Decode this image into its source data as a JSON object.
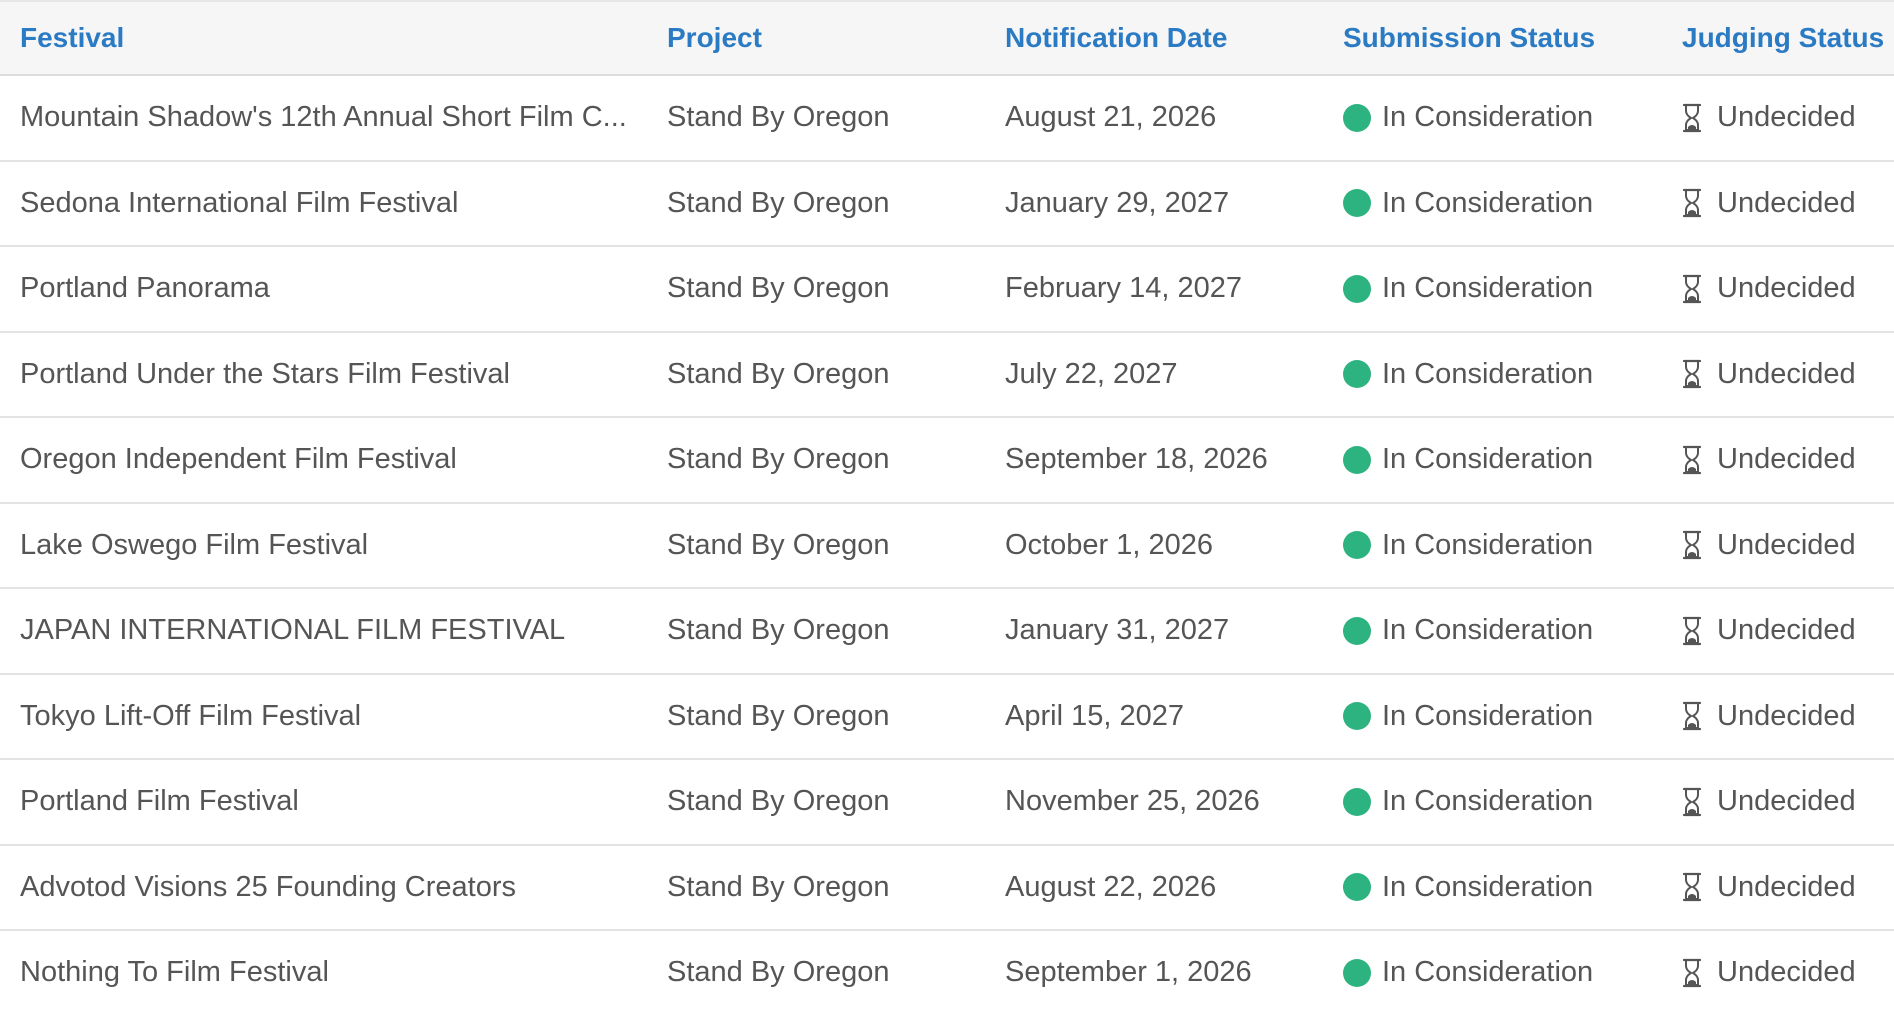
{
  "colors": {
    "header_text": "#2b7bc4",
    "status_dot": "#2db37f",
    "body_text": "#555555"
  },
  "header": {
    "festival": "Festival",
    "project": "Project",
    "notification_date": "Notification Date",
    "submission_status": "Submission Status",
    "judging_status": "Judging Status"
  },
  "rows": [
    {
      "festival": "Mountain Shadow's 12th Annual Short Film C...",
      "project": "Stand By Oregon",
      "date": "August 21, 2026",
      "submission": "In Consideration",
      "judging": "Undecided",
      "judging_icon": "hourglass-icon"
    },
    {
      "festival": "Sedona International Film Festival",
      "project": "Stand By Oregon",
      "date": "January 29, 2027",
      "submission": "In Consideration",
      "judging": "Undecided",
      "judging_icon": "hourglass-icon"
    },
    {
      "festival": "Portland Panorama",
      "project": "Stand By Oregon",
      "date": "February 14, 2027",
      "submission": "In Consideration",
      "judging": "Undecided",
      "judging_icon": "hourglass-icon"
    },
    {
      "festival": "Portland Under the Stars Film Festival",
      "project": "Stand By Oregon",
      "date": "July 22, 2027",
      "submission": "In Consideration",
      "judging": "Undecided",
      "judging_icon": "hourglass-icon"
    },
    {
      "festival": "Oregon Independent Film Festival",
      "project": "Stand By Oregon",
      "date": "September 18, 2026",
      "submission": "In Consideration",
      "judging": "Undecided",
      "judging_icon": "hourglass-icon"
    },
    {
      "festival": "Lake Oswego Film Festival",
      "project": "Stand By Oregon",
      "date": "October 1, 2026",
      "submission": "In Consideration",
      "judging": "Undecided",
      "judging_icon": "hourglass-icon"
    },
    {
      "festival": "JAPAN INTERNATIONAL FILM FESTIVAL",
      "project": "Stand By Oregon",
      "date": "January 31, 2027",
      "submission": "In Consideration",
      "judging": "Undecided",
      "judging_icon": "hourglass-icon"
    },
    {
      "festival": "Tokyo Lift-Off Film Festival",
      "project": "Stand By Oregon",
      "date": "April 15, 2027",
      "submission": "In Consideration",
      "judging": "Undecided",
      "judging_icon": "hourglass-icon"
    },
    {
      "festival": "Portland Film Festival",
      "project": "Stand By Oregon",
      "date": "November 25, 2026",
      "submission": "In Consideration",
      "judging": "Undecided",
      "judging_icon": "hourglass-icon"
    },
    {
      "festival": "Advotod Visions 25 Founding Creators",
      "project": "Stand By Oregon",
      "date": "August 22, 2026",
      "submission": "In Consideration",
      "judging": "Undecided",
      "judging_icon": "hourglass-icon"
    },
    {
      "festival": "Nothing To Film Festival",
      "project": "Stand By Oregon",
      "date": "September 1, 2026",
      "submission": "In Consideration",
      "judging": "Undecided",
      "judging_icon": "hourglass-icon"
    }
  ]
}
